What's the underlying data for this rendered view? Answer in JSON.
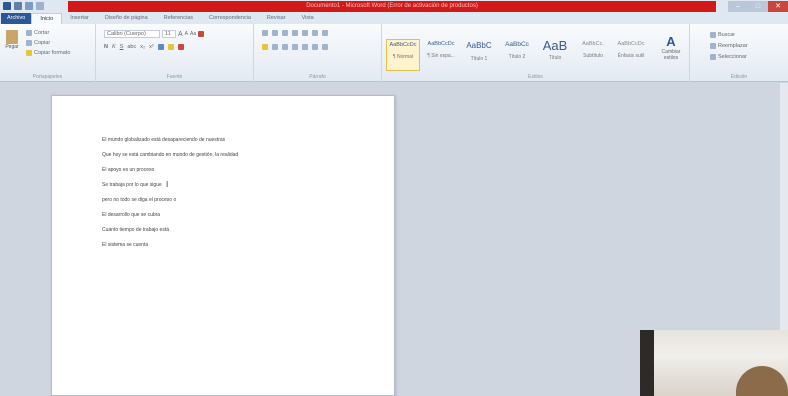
{
  "window": {
    "title": "Documento1 - Microsoft Word (Error de activación de productos)",
    "controls": [
      "minimize",
      "maximize",
      "close"
    ]
  },
  "quick_access": [
    "save-icon",
    "undo-icon",
    "redo-icon",
    "customize-icon"
  ],
  "tabs": [
    "Archivo",
    "Inicio",
    "Insertar",
    "Diseño de página",
    "Referencias",
    "Correspondencia",
    "Revisar",
    "Vista"
  ],
  "active_tab": "Inicio",
  "ribbon": {
    "clipboard": {
      "paste_label": "Pegar",
      "cut_label": "Cortar",
      "copy_label": "Copiar",
      "format_painter_label": "Copiar formato",
      "group_label": "Portapapeles"
    },
    "font": {
      "font_name": "Calibri (Cuerpo)",
      "font_size": "11",
      "group_label": "Fuente"
    },
    "paragraph": {
      "group_label": "Párrafo"
    },
    "styles": {
      "items": [
        {
          "sample": "AaBbCcDc",
          "name": "¶ Normal",
          "active": true
        },
        {
          "sample": "AaBbCcDc",
          "name": "¶ Sin espa...",
          "active": false
        },
        {
          "sample": "AaBbC",
          "name": "Título 1",
          "active": false
        },
        {
          "sample": "AaBbCc",
          "name": "Título 2",
          "active": false
        },
        {
          "sample": "AaB",
          "name": "Título",
          "active": false
        },
        {
          "sample": "AaBbCc.",
          "name": "Subtítulo",
          "active": false
        },
        {
          "sample": "AaBbCcDc",
          "name": "Énfasis sutil",
          "active": false
        }
      ],
      "change_styles_label": "Cambiar estilos",
      "group_label": "Estilos"
    },
    "editing": {
      "find_label": "Buscar",
      "replace_label": "Reemplazar",
      "select_label": "Seleccionar",
      "group_label": "Edición"
    }
  },
  "document": {
    "lines": [
      "El mundo globalizado está desapareciendo de nuestras",
      "Que hoy se está cambiando en mundo de gestión, la realidad",
      "El apoyo es un proceso",
      "Se trabaja por lo que sigue",
      "pero no todo se diga el proceso o",
      "El desarrollo que se cubra",
      "Cuánto tiempo de trabajo está",
      "El sistema se cuenta"
    ]
  },
  "colors": {
    "title_bar_accent": "#d31818",
    "file_tab": "#2b5797",
    "workspace_bg": "#cfd6df"
  }
}
